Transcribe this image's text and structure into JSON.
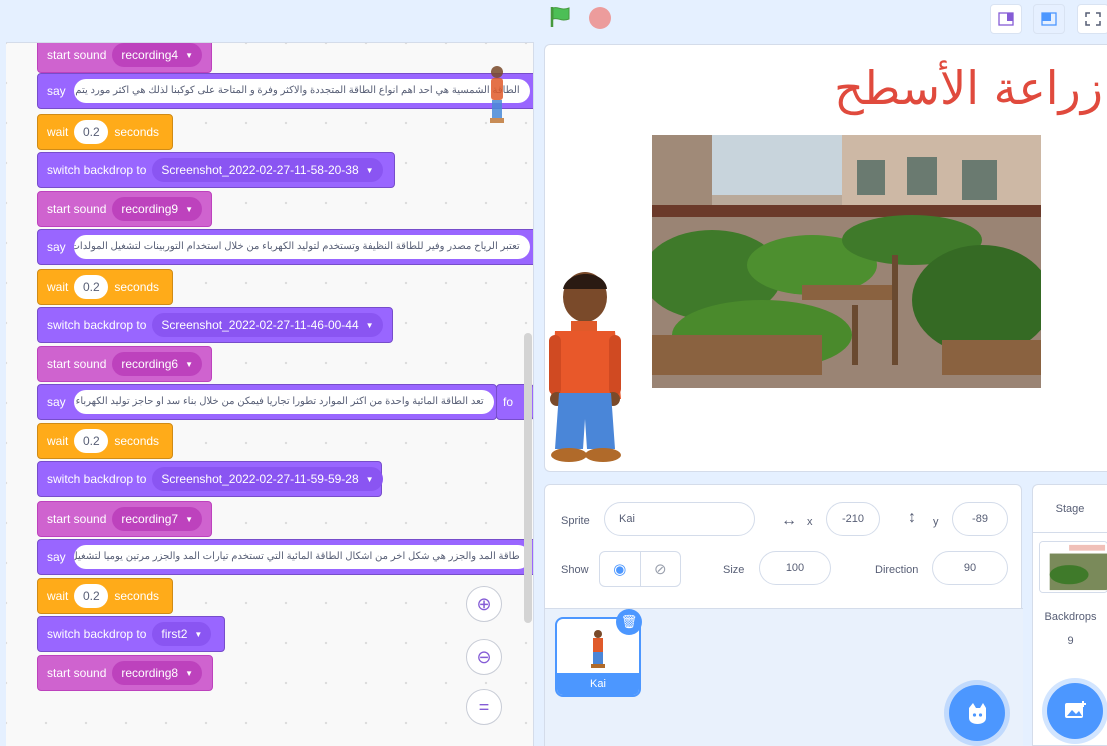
{
  "code": {
    "blocks": [
      {
        "kind": "sound",
        "label": "start sound",
        "value": "recording4"
      },
      {
        "kind": "say",
        "label": "say",
        "text": "الطاقة الشمسية هي احد اهم انواع الطاقة المتجددة والاكثر وفرة و المتاحة على كوكبنا لذلك هي اكثر مورد يتم الاعتماد عليها"
      },
      {
        "kind": "wait",
        "label": "wait",
        "value": "0.2",
        "suffix": "seconds"
      },
      {
        "kind": "backdrop",
        "label": "switch backdrop to",
        "value": "Screenshot_2022-02-27-11-58-20-38"
      },
      {
        "kind": "sound",
        "label": "start sound",
        "value": "recording9"
      },
      {
        "kind": "say",
        "label": "say",
        "text": "تعتبر الرياح مصدر وفير للطاقة النظيفة وتستخدم لتوليد الكهرباء من خلال استخدام التوربينات لتشغيل المولدات التي تغذي الكهرباء"
      },
      {
        "kind": "wait",
        "label": "wait",
        "value": "0.2",
        "suffix": "seconds"
      },
      {
        "kind": "backdrop",
        "label": "switch backdrop to",
        "value": "Screenshot_2022-02-27-11-46-00-44"
      },
      {
        "kind": "sound",
        "label": "start sound",
        "value": "recording6"
      },
      {
        "kind": "say",
        "label": "say",
        "text": "تعد الطاقة المائية واحدة من اكثر الموارد تطورا تجاريا فيمكن من خلال بناء سد او حاجز توليد الكهرباء"
      },
      {
        "kind": "wait",
        "label": "wait",
        "value": "0.2",
        "suffix": "seconds"
      },
      {
        "kind": "backdrop",
        "label": "switch backdrop to",
        "value": "Screenshot_2022-02-27-11-59-59-28"
      },
      {
        "kind": "sound",
        "label": "start sound",
        "value": "recording7"
      },
      {
        "kind": "say",
        "label": "say",
        "text": "طاقة المد والجزر هي شكل اخر من اشكال الطاقة المائية التي تستخدم تيارات المد والجزر مرتين يوميا لتشغيل مولدات التوربينات"
      },
      {
        "kind": "wait",
        "label": "wait",
        "value": "0.2",
        "suffix": "seconds"
      },
      {
        "kind": "backdrop",
        "label": "switch backdrop to",
        "value": "first2"
      },
      {
        "kind": "sound",
        "label": "start sound",
        "value": "recording8"
      }
    ],
    "stray_fragment": "fo"
  },
  "stage": {
    "title": "زراعة الأسطح"
  },
  "sprite": {
    "sprite_label": "Sprite",
    "name": "Kai",
    "x_label": "x",
    "x": "-210",
    "y_label": "y",
    "y": "-89",
    "show_label": "Show",
    "size_label": "Size",
    "size": "100",
    "direction_label": "Direction",
    "direction": "90"
  },
  "sprite_list": [
    {
      "name": "Kai"
    }
  ],
  "stage_panel": {
    "title": "Stage",
    "backdrops_label": "Backdrops",
    "backdrops_count": "9"
  },
  "icons": [
    "green-flag-icon",
    "stop-icon",
    "small-stage-icon",
    "normal-stage-icon",
    "fullscreen-icon",
    "zoom-in-icon",
    "zoom-out-icon",
    "zoom-reset-icon",
    "eye-icon",
    "eye-slash-icon",
    "trash-icon",
    "choose-sprite-icon",
    "choose-backdrop-icon"
  ],
  "colors": {
    "sound": "#cf63cf",
    "looks": "#9966ff",
    "control": "#ffab19",
    "accent": "#4c97ff",
    "title": "#e04a3d"
  }
}
